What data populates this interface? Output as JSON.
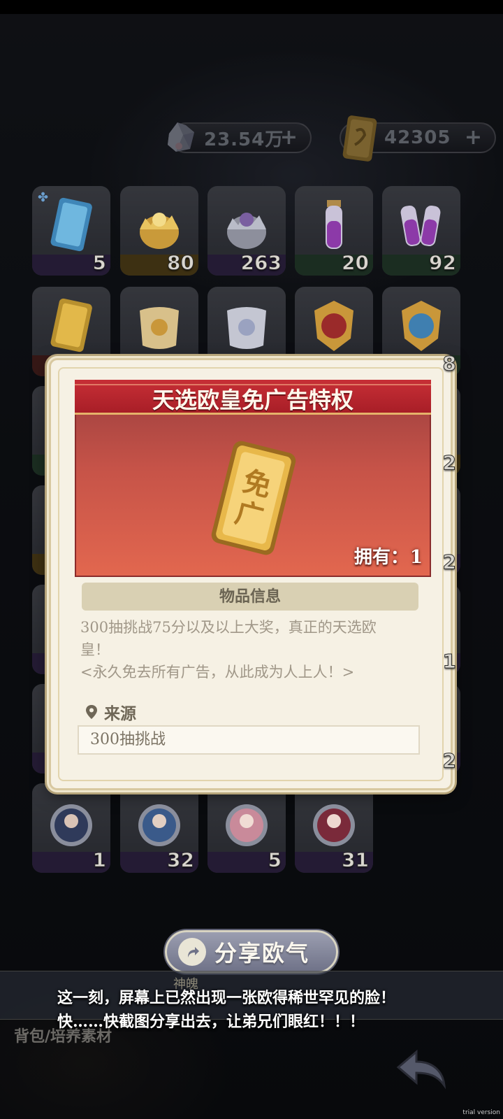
{
  "currency": {
    "gems": "23.54万",
    "tickets": "42305",
    "plus": "+"
  },
  "inventory": {
    "row1": [
      "5",
      "80",
      "263",
      "20",
      "92"
    ],
    "row2_last_partial": "8",
    "side_partials": [
      "2",
      "2",
      "1",
      "2"
    ],
    "row_bottom": [
      "1",
      "32",
      "5",
      "31"
    ]
  },
  "modal": {
    "title": "天选欧皇免广告特权",
    "owned_label": "拥有：",
    "owned_value": "1",
    "info_header": "物品信息",
    "description_line1": "300抽挑战75分以及以上大奖，真正的天选欧",
    "description_line2": "皇！",
    "description_line3": "<永久免去所有广告，从此成为人上人！>",
    "source_label": "来源",
    "source_value": "300抽挑战",
    "item_icon": "ad-free-ticket-icon"
  },
  "share": {
    "label": "分享欧气",
    "icon": "share-arrow-icon"
  },
  "bottom": {
    "tab_label": "背包/培养素材",
    "faint_text": "神魄",
    "back_icon": "back-arrow-icon"
  },
  "caption": {
    "line1": "这一刻，屏幕上已然出现一张欧得稀世罕见的脸！",
    "line2": "快……快截图分享出去，让弟兄们眼红！！！"
  },
  "watermark": "trial version",
  "colors": {
    "banner_red": "#c72f36",
    "modal_bg": "#f6f1e4",
    "gold": "#e8b84a"
  }
}
